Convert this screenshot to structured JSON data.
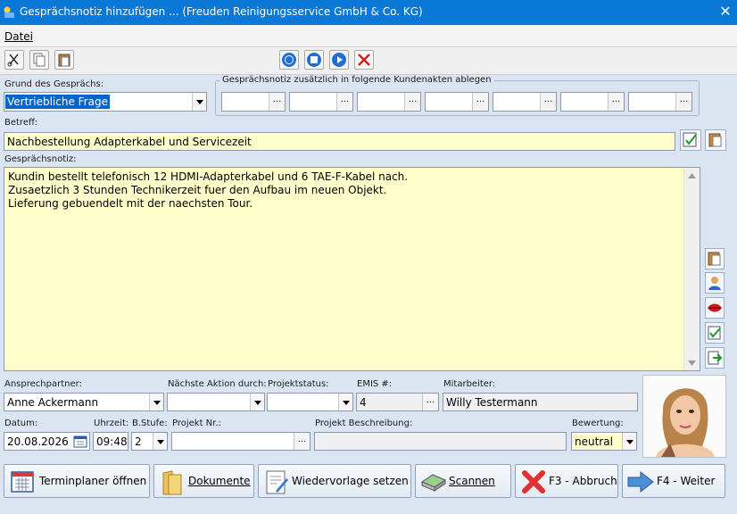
{
  "window": {
    "title": "Gesprächsnotiz hinzufügen ... (Freuden Reinigungsservice GmbH & Co. KG)",
    "close": "✕"
  },
  "menu": {
    "datei": "Datei"
  },
  "form": {
    "grund_label": "Grund des Gesprächs:",
    "grund_value": "Vertriebliche Frage",
    "kundenakten_label": "Gesprächsnotiz zusätzlich in folgende Kundenakten ablegen",
    "kundenakten_dots": "...",
    "betreff_label": "Betreff:",
    "betreff_value": "Nachbestellung Adapterkabel und Servicezeit",
    "notiz_label": "Gesprächsnotiz:",
    "notiz_lines": [
      "Kundin bestellt telefonisch 12 HDMI-Adapterkabel und 6 TAE-F-Kabel nach.",
      "Zusaetzlich 3 Stunden Technikerzeit fuer den Aufbau im neuen Objekt.",
      "Lieferung gebuendelt mit der naechsten Tour."
    ],
    "ansprech_label": "Ansprechpartner:",
    "ansprech_value": "Anne Ackermann",
    "naechste_label": "Nächste Aktion durch:",
    "naechste_value": "",
    "projektstatus_label": "Projektstatus:",
    "projektstatus_value": "",
    "emis_label": "EMIS #:",
    "emis_value": "4",
    "mitarbeiter_label": "Mitarbeiter:",
    "mitarbeiter_value": "Willy Testermann",
    "datum_label": "Datum:",
    "datum_value": "20.08.2026",
    "uhrzeit_label": "Uhrzeit:",
    "uhrzeit_value": "09:48",
    "bstufe_label": "B.Stufe:",
    "bstufe_value": "2",
    "projektnr_label": "Projekt Nr.:",
    "projektnr_value": "",
    "projektbeschr_label": "Projekt Beschreibung:",
    "projektbeschr_value": "",
    "bewertung_label": "Bewertung:",
    "bewertung_value": "neutral",
    "dots": "..."
  },
  "buttons": {
    "terminplaner": "Terminplaner öffnen",
    "dokumente": "Dokumente",
    "wiedervorlage": "Wiedervorlage setzen",
    "scannen": "Scannen",
    "abbruch": "F3 - Abbruch",
    "weiter": "F4 - Weiter"
  },
  "colors": {
    "titlebar": "#0a78d7",
    "yellow_field": "#ffffcc",
    "selection": "#0a64c8",
    "background": "#dbe5f1"
  },
  "icons": [
    "app-icon",
    "scissors-icon",
    "copy-icon",
    "paste-icon",
    "record-icon",
    "stop-icon",
    "play-icon",
    "delete-x-icon",
    "calendar-icon",
    "folder-icon",
    "document-edit-icon",
    "scanner-icon",
    "cancel-x-icon",
    "arrow-right-icon",
    "person-icon",
    "lips-icon"
  ]
}
